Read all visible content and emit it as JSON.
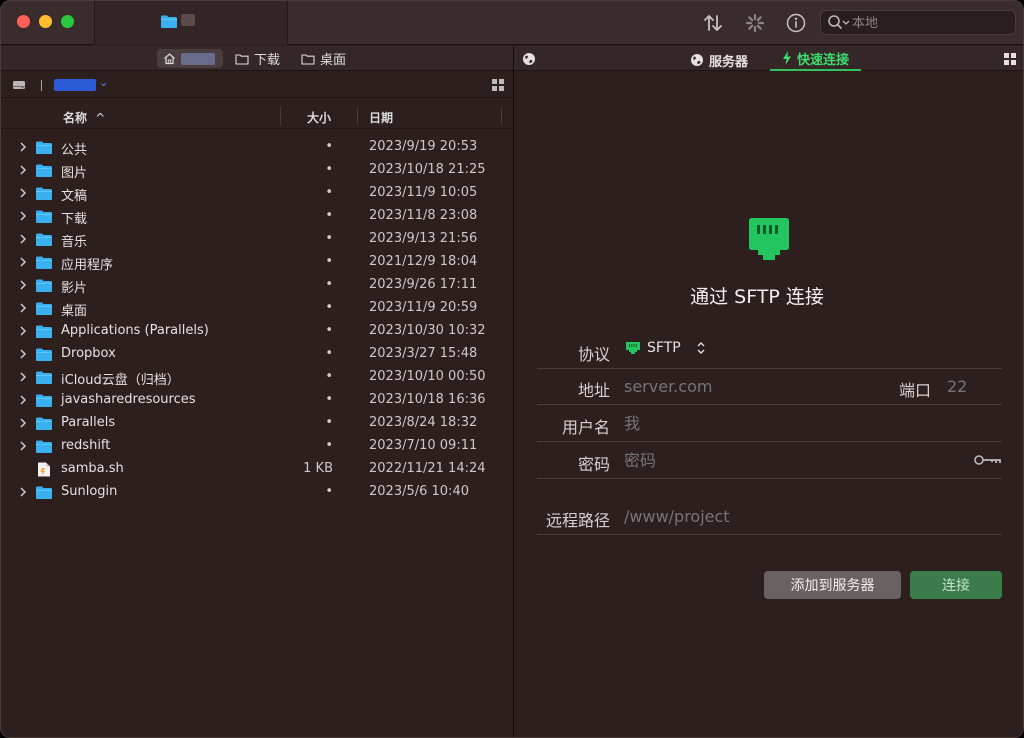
{
  "titlebar": {
    "search_placeholder": "本地",
    "icons": [
      "transfer-icon",
      "activity-icon",
      "info-icon",
      "search-icon"
    ]
  },
  "left": {
    "breadcrumbs": {
      "downloads": "下载",
      "desktop": "桌面"
    },
    "columns": {
      "name": "名称",
      "size": "大小",
      "date": "日期"
    },
    "files": [
      {
        "name": "公共",
        "size": "•",
        "date": "2023/9/19 20:53",
        "type": "folder"
      },
      {
        "name": "图片",
        "size": "•",
        "date": "2023/10/18 21:25",
        "type": "folder"
      },
      {
        "name": "文稿",
        "size": "•",
        "date": "2023/11/9 10:05",
        "type": "folder"
      },
      {
        "name": "下载",
        "size": "•",
        "date": "2023/11/8 23:08",
        "type": "folder"
      },
      {
        "name": "音乐",
        "size": "•",
        "date": "2023/9/13 21:56",
        "type": "folder"
      },
      {
        "name": "应用程序",
        "size": "•",
        "date": "2021/12/9 18:04",
        "type": "folder"
      },
      {
        "name": "影片",
        "size": "•",
        "date": "2023/9/26 17:11",
        "type": "folder"
      },
      {
        "name": "桌面",
        "size": "•",
        "date": "2023/11/9 20:59",
        "type": "folder"
      },
      {
        "name": "Applications (Parallels)",
        "size": "•",
        "date": "2023/10/30 10:32",
        "type": "folder"
      },
      {
        "name": "Dropbox",
        "size": "•",
        "date": "2023/3/27 15:48",
        "type": "folder"
      },
      {
        "name": "iCloud云盘（归档）",
        "size": "•",
        "date": "2023/10/10 00:50",
        "type": "folder"
      },
      {
        "name": "javasharedresources",
        "size": "•",
        "date": "2023/10/18 16:36",
        "type": "folder"
      },
      {
        "name": "Parallels",
        "size": "•",
        "date": "2023/8/24 18:32",
        "type": "folder"
      },
      {
        "name": "redshift",
        "size": "•",
        "date": "2023/7/10 09:11",
        "type": "folder"
      },
      {
        "name": "samba.sh",
        "size": "1 KB",
        "date": "2022/11/21 14:24",
        "type": "file"
      },
      {
        "name": "Sunlogin",
        "size": "•",
        "date": "2023/5/6 10:40",
        "type": "folder"
      }
    ]
  },
  "right": {
    "tabs": {
      "servers": "服务器",
      "quick_connect": "快速连接"
    },
    "title": "通过 SFTP 连接",
    "form": {
      "protocol_label": "协议",
      "protocol_value": "SFTP",
      "address_label": "地址",
      "address_placeholder": "server.com",
      "port_label": "端口",
      "port_placeholder": "22",
      "username_label": "用户名",
      "username_placeholder": "我",
      "password_label": "密码",
      "password_placeholder": "密码",
      "remote_path_label": "远程路径",
      "remote_path_placeholder": "/www/project"
    },
    "buttons": {
      "add_to_servers": "添加到服务器",
      "connect": "连接"
    }
  },
  "colors": {
    "background": "#2e1f1f",
    "accent_green": "#3ddc6c",
    "connect_button": "#3a7d4a",
    "folder_blue": "#3ab0ef"
  }
}
